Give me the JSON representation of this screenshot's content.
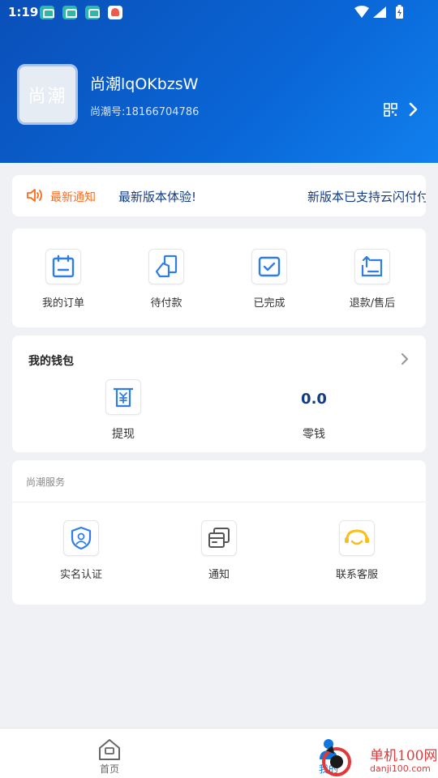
{
  "status_bar": {
    "time": "1:19",
    "icons": [
      "app-notification-icon",
      "app-notification-icon",
      "app-notification-icon",
      "health-app-icon",
      "wifi-icon",
      "signal-icon",
      "battery-charging-icon"
    ]
  },
  "profile": {
    "avatar_text": "尚潮",
    "username": "尚潮lqOKbzsW",
    "user_id": "尚潮号:18166704786"
  },
  "notice": {
    "label": "最新通知",
    "messages": [
      "最新版本体验!",
      "新版本已支持云闪付付"
    ]
  },
  "orders": {
    "items": [
      {
        "label": "我的订单",
        "icon": "order-calendar-icon"
      },
      {
        "label": "待付款",
        "icon": "pending-payment-icon"
      },
      {
        "label": "已完成",
        "icon": "completed-check-icon"
      },
      {
        "label": "退款/售后",
        "icon": "refund-icon"
      }
    ]
  },
  "wallet": {
    "title": "我的钱包",
    "withdraw_label": "提现",
    "change_amount": "0.0",
    "change_label": "零钱"
  },
  "services": {
    "title": "尚潮服务",
    "items": [
      {
        "label": "实名认证",
        "icon": "identity-shield-icon"
      },
      {
        "label": "通知",
        "icon": "notification-cards-icon"
      },
      {
        "label": "联系客服",
        "icon": "customer-service-icon"
      }
    ]
  },
  "tabbar": {
    "home_label": "首页",
    "mine_label": "我的"
  },
  "watermark": {
    "text": "单机100网",
    "url": "danji100.com"
  },
  "colors": {
    "header_blue": "#0a5ccc",
    "accent_navy": "#123c85",
    "notice_orange": "#ff6a1a",
    "icon_blue": "#2f7ee8",
    "watermark_red": "#e23838"
  }
}
